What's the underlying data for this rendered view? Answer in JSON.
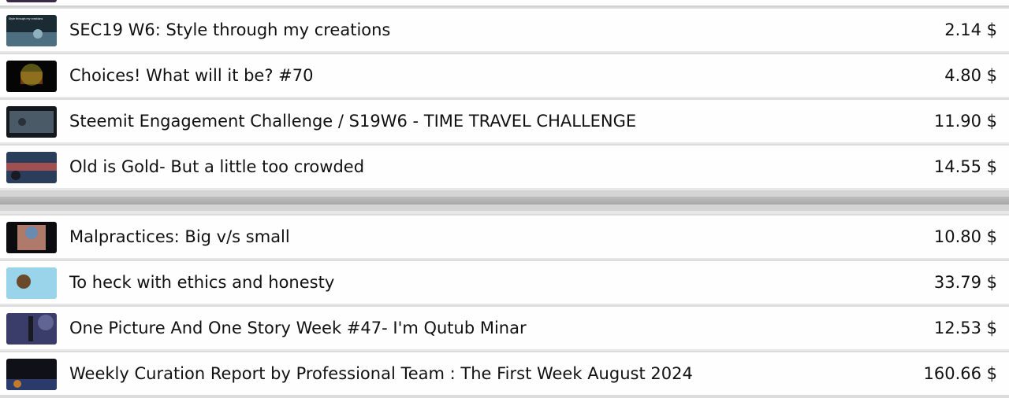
{
  "posts_group_1": [
    {
      "title": "SEC19 W6: Style through my creations",
      "price": "2.14 $",
      "thumb_text": "Style through my creations",
      "thumb_colors": [
        "#1b2b33",
        "#4d6f80",
        "#8fb0bd"
      ]
    },
    {
      "title": "Choices! What will it be? #70",
      "price": "4.80 $",
      "thumb_colors": [
        "#050505",
        "#b0a32a",
        "#6a3a10"
      ]
    },
    {
      "title": "Steemit Engagement Challenge / S19W6 - TIME TRAVEL CHALLENGE",
      "price": "11.90 $",
      "thumb_colors": [
        "#14181c",
        "#4a5a66",
        "#2a3038"
      ]
    },
    {
      "title": "Old is Gold- But a little too crowded",
      "price": "14.55 $",
      "thumb_colors": [
        "#2a3d5a",
        "#a05050",
        "#1a1a24"
      ]
    }
  ],
  "posts_group_2": [
    {
      "title": "Malpractices: Big v/s small",
      "price": "10.80 $",
      "thumb_colors": [
        "#0c0c10",
        "#b07a6a",
        "#6a8ab0"
      ]
    },
    {
      "title": "To heck with ethics and honesty",
      "price": "33.79 $",
      "thumb_colors": [
        "#9ad4ea",
        "#6a4a2a",
        "#2a3a7a"
      ]
    },
    {
      "title": "One Picture And One Story Week #47- I'm Qutub Minar",
      "price": "12.53 $",
      "thumb_colors": [
        "#3a3c6a",
        "#1a1a22",
        "#7a80b0"
      ]
    },
    {
      "title": "Weekly Curation Report by Professional Team : The First Week August 2024",
      "price": "160.66 $",
      "thumb_colors": [
        "#101018",
        "#2a3a6a",
        "#c07a2a"
      ]
    }
  ]
}
